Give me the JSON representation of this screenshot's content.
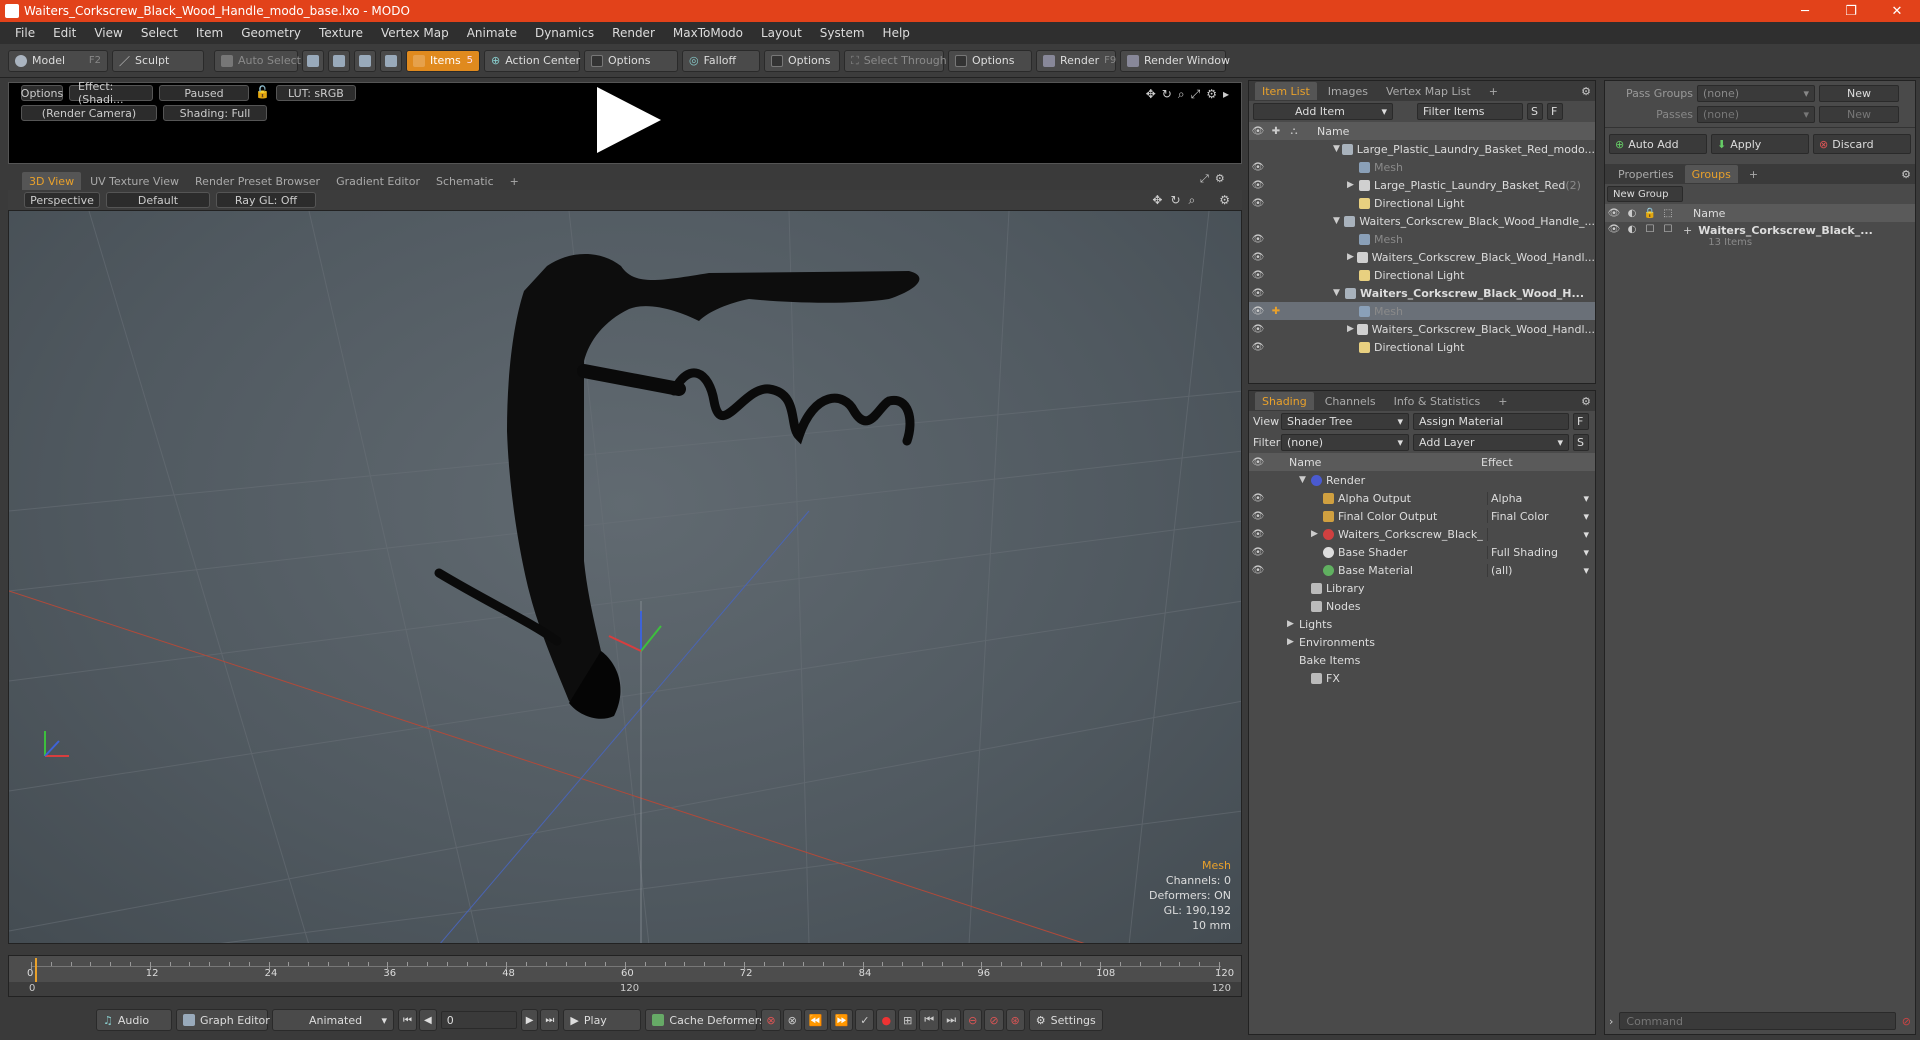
{
  "window": {
    "title": "Waiters_Corkscrew_Black_Wood_Handle_modo_base.lxo - MODO",
    "minimize": "─",
    "maximize": "❐",
    "close": "✕"
  },
  "menu": [
    "File",
    "Edit",
    "View",
    "Select",
    "Item",
    "Geometry",
    "Texture",
    "Vertex Map",
    "Animate",
    "Dynamics",
    "Render",
    "MaxToModo",
    "Layout",
    "System",
    "Help"
  ],
  "toolbar": {
    "model": "Model",
    "model_key": "F2",
    "sculpt": "Sculpt",
    "auto_select": "Auto Select",
    "items": "Items",
    "items_key": "5",
    "action_center": "Action Center",
    "options1": "Options",
    "falloff": "Falloff",
    "options2": "Options",
    "select_through": "Select Through",
    "options3": "Options",
    "render": "Render",
    "render_key": "F9",
    "render_window": "Render Window"
  },
  "preview": {
    "options": "Options",
    "effect": "Effect: (Shadi...",
    "paused": "Paused",
    "lut": "LUT: sRGB",
    "camera": "(Render Camera)",
    "shading": "Shading: Full"
  },
  "viewport_tabs": [
    "3D View",
    "UV Texture View",
    "Render Preset Browser",
    "Gradient Editor",
    "Schematic",
    "+"
  ],
  "viewport_bar": {
    "perspective": "Perspective",
    "default": "Default",
    "raygl": "Ray GL: Off"
  },
  "viewport_info": {
    "selection": "Mesh",
    "channels": "Channels: 0",
    "deformers": "Deformers: ON",
    "gl": "GL: 190,192",
    "units": "10 mm"
  },
  "timeline": {
    "ticks": [
      "0",
      "12",
      "24",
      "36",
      "48",
      "60",
      "72",
      "84",
      "96",
      "108",
      "120"
    ],
    "start": "0",
    "mid": "120",
    "end": "120"
  },
  "bottom": {
    "audio": "Audio",
    "graph_editor": "Graph Editor",
    "animated": "Animated",
    "frame": "0",
    "play": "Play",
    "cache_deformers": "Cache Deformers",
    "settings": "Settings"
  },
  "item_list": {
    "tabs": [
      "Item List",
      "Images",
      "Vertex Map List",
      "+"
    ],
    "add_item": "Add Item",
    "filter_items": "Filter Items",
    "s": "S",
    "f": "F",
    "col_name": "Name",
    "rows": [
      {
        "label": "Large_Plastic_Laundry_Basket_Red_modo...",
        "indent": 0,
        "kind": "scene",
        "eye": false,
        "expand": "▼"
      },
      {
        "label": "Mesh",
        "indent": 1,
        "kind": "mesh",
        "eye": true,
        "dim": true,
        "expand": ""
      },
      {
        "label": "Large_Plastic_Laundry_Basket_Red",
        "suffix": " (2)",
        "indent": 1,
        "kind": "group",
        "eye": true,
        "expand": "▶"
      },
      {
        "label": "Directional Light",
        "indent": 1,
        "kind": "light",
        "eye": true,
        "expand": ""
      },
      {
        "label": "Waiters_Corkscrew_Black_Wood_Handle_...",
        "indent": 0,
        "kind": "scene",
        "eye": false,
        "expand": "▼"
      },
      {
        "label": "Mesh",
        "indent": 1,
        "kind": "mesh",
        "eye": true,
        "dim": true,
        "expand": ""
      },
      {
        "label": "Waiters_Corkscrew_Black_Wood_Handl...",
        "indent": 1,
        "kind": "group",
        "eye": true,
        "expand": "▶"
      },
      {
        "label": "Directional Light",
        "indent": 1,
        "kind": "light",
        "eye": true,
        "expand": ""
      },
      {
        "label": "Waiters_Corkscrew_Black_Wood_H...",
        "indent": 0,
        "kind": "scene",
        "eye": true,
        "bold": true,
        "expand": "▼"
      },
      {
        "label": "Mesh",
        "indent": 1,
        "kind": "mesh",
        "eye": true,
        "dim": true,
        "selected": true,
        "expand": ""
      },
      {
        "label": "Waiters_Corkscrew_Black_Wood_Handl...",
        "indent": 1,
        "kind": "group",
        "eye": true,
        "expand": "▶"
      },
      {
        "label": "Directional Light",
        "indent": 1,
        "kind": "light",
        "eye": true,
        "expand": ""
      }
    ]
  },
  "shading": {
    "tabs": [
      "Shading",
      "Channels",
      "Info & Statistics",
      "+"
    ],
    "view_label": "View",
    "view_value": "Shader Tree",
    "assign_material": "Assign Material",
    "f": "F",
    "filter_label": "Filter",
    "filter_value": "(none)",
    "add_layer": "Add Layer",
    "s": "S",
    "col_name": "Name",
    "col_effect": "Effect",
    "rows": [
      {
        "label": "Render",
        "effect": "",
        "indent": 0,
        "kind": "render",
        "eye": false,
        "expand": "▼"
      },
      {
        "label": "Alpha Output",
        "effect": "Alpha",
        "indent": 1,
        "kind": "output",
        "eye": true,
        "expand": ""
      },
      {
        "label": "Final Color Output",
        "effect": "Final Color",
        "indent": 1,
        "kind": "output",
        "eye": true,
        "expand": ""
      },
      {
        "label": "Waiters_Corkscrew_Black_ ...",
        "effect": "",
        "indent": 1,
        "kind": "material",
        "eye": true,
        "expand": "▶"
      },
      {
        "label": "Base Shader",
        "effect": "Full Shading",
        "indent": 1,
        "kind": "shader",
        "eye": true,
        "expand": ""
      },
      {
        "label": "Base Material",
        "effect": "(all)",
        "indent": 1,
        "kind": "basemat",
        "eye": true,
        "expand": ""
      },
      {
        "label": "Library",
        "effect": "",
        "indent": 0,
        "kind": "folder",
        "eye": false,
        "expand": ""
      },
      {
        "label": "Nodes",
        "effect": "",
        "indent": 0,
        "kind": "folder",
        "eye": false,
        "expand": ""
      },
      {
        "label": "Lights",
        "effect": "",
        "indent": -1,
        "kind": "none",
        "eye": false,
        "expand": "▶"
      },
      {
        "label": "Environments",
        "effect": "",
        "indent": -1,
        "kind": "none",
        "eye": false,
        "expand": "▶"
      },
      {
        "label": "Bake Items",
        "effect": "",
        "indent": -1,
        "kind": "none",
        "eye": false,
        "expand": ""
      },
      {
        "label": "FX",
        "effect": "",
        "indent": 0,
        "kind": "fx",
        "eye": false,
        "expand": ""
      }
    ]
  },
  "right_panel": {
    "pass_groups_label": "Pass Groups",
    "pass_groups_value": "(none)",
    "new": "New",
    "passes_label": "Passes",
    "passes_value": "(none)",
    "new2": "New",
    "auto_add": "Auto Add",
    "apply": "Apply",
    "discard": "Discard",
    "tabs": [
      "Properties",
      "Groups",
      "+"
    ],
    "new_group": "New Group",
    "col_name": "Name",
    "group_name": "Waiters_Corkscrew_Black_...",
    "group_count": "13 Items",
    "command_placeholder": "Command"
  }
}
